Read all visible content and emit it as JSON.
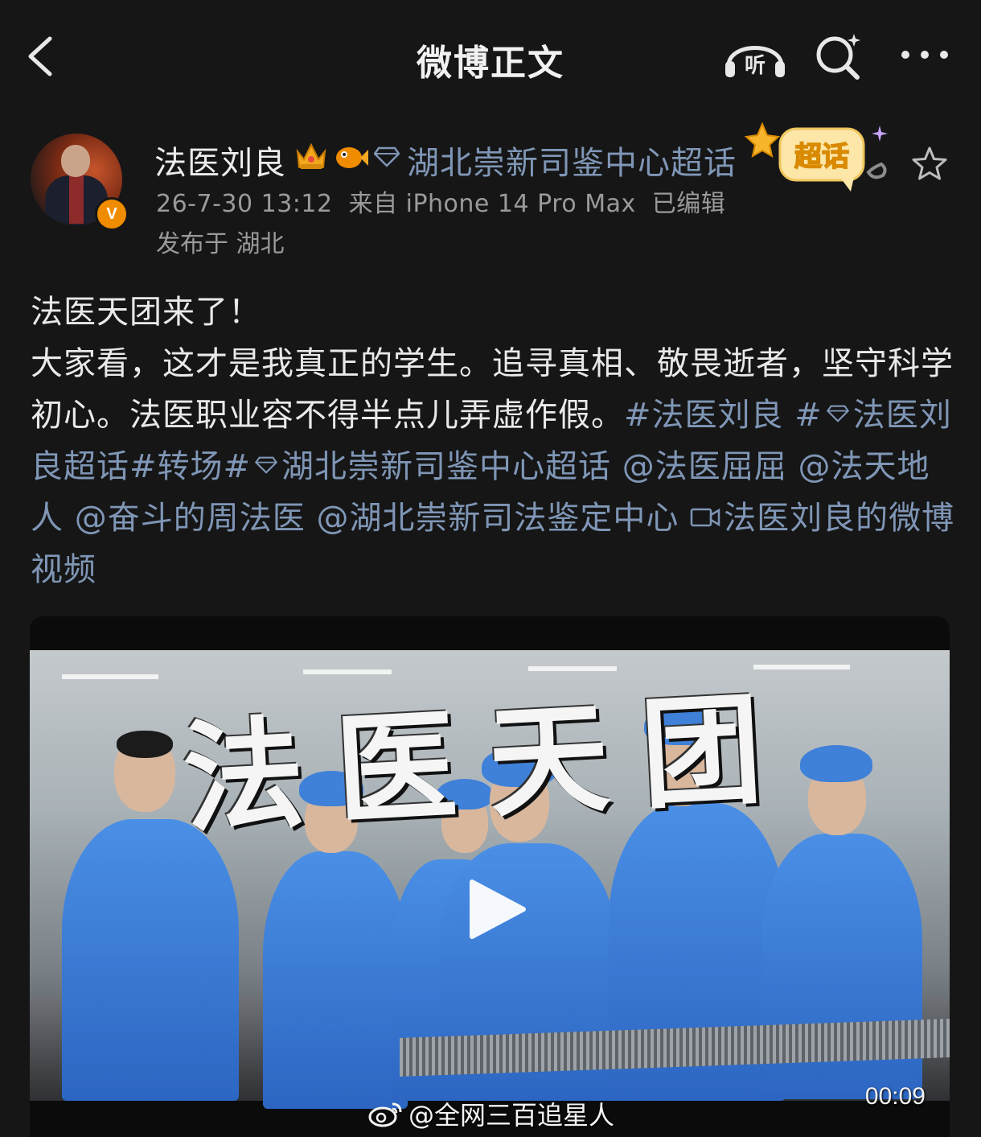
{
  "nav": {
    "title": "微博正文",
    "listen_label": "听"
  },
  "post": {
    "author": "法医刘良",
    "verified_badge": "V",
    "topic": "湖北崇新司鉴中心超话",
    "chaohua_badge": "超话",
    "timestamp": "26-7-30 13:12",
    "source": "来自 iPhone 14 Pro Max",
    "edited": "已编辑",
    "location": "发布于 湖北",
    "text_line1": "法医天团来了！",
    "text_line2": "大家看，这才是我真正的学生。追寻真相、敬畏逝者，坚守科学初心。法医职业容不得半点儿弄虚作假。",
    "tag1": "#法医刘良",
    "tag2_prefix": "#",
    "tag2": "法医刘良超话",
    "tag3": "#转场",
    "tag4_prefix": "#",
    "tag4": "湖北崇新司鉴中心超话",
    "mention1": "@法医屈屈",
    "mention2": "@法天地人",
    "mention3": "@奋斗的周法医",
    "mention4": "@湖北崇新司法鉴定中心",
    "video_link": "法医刘良的微博视频"
  },
  "video": {
    "overlay_title": "法医天团",
    "duration": "00:09"
  },
  "watermark": {
    "text": "@全网三百追星人"
  },
  "colors": {
    "background": "#161616",
    "link": "#7f96b6",
    "meta": "#9a9a9a",
    "accent_orange": "#f08c00"
  }
}
